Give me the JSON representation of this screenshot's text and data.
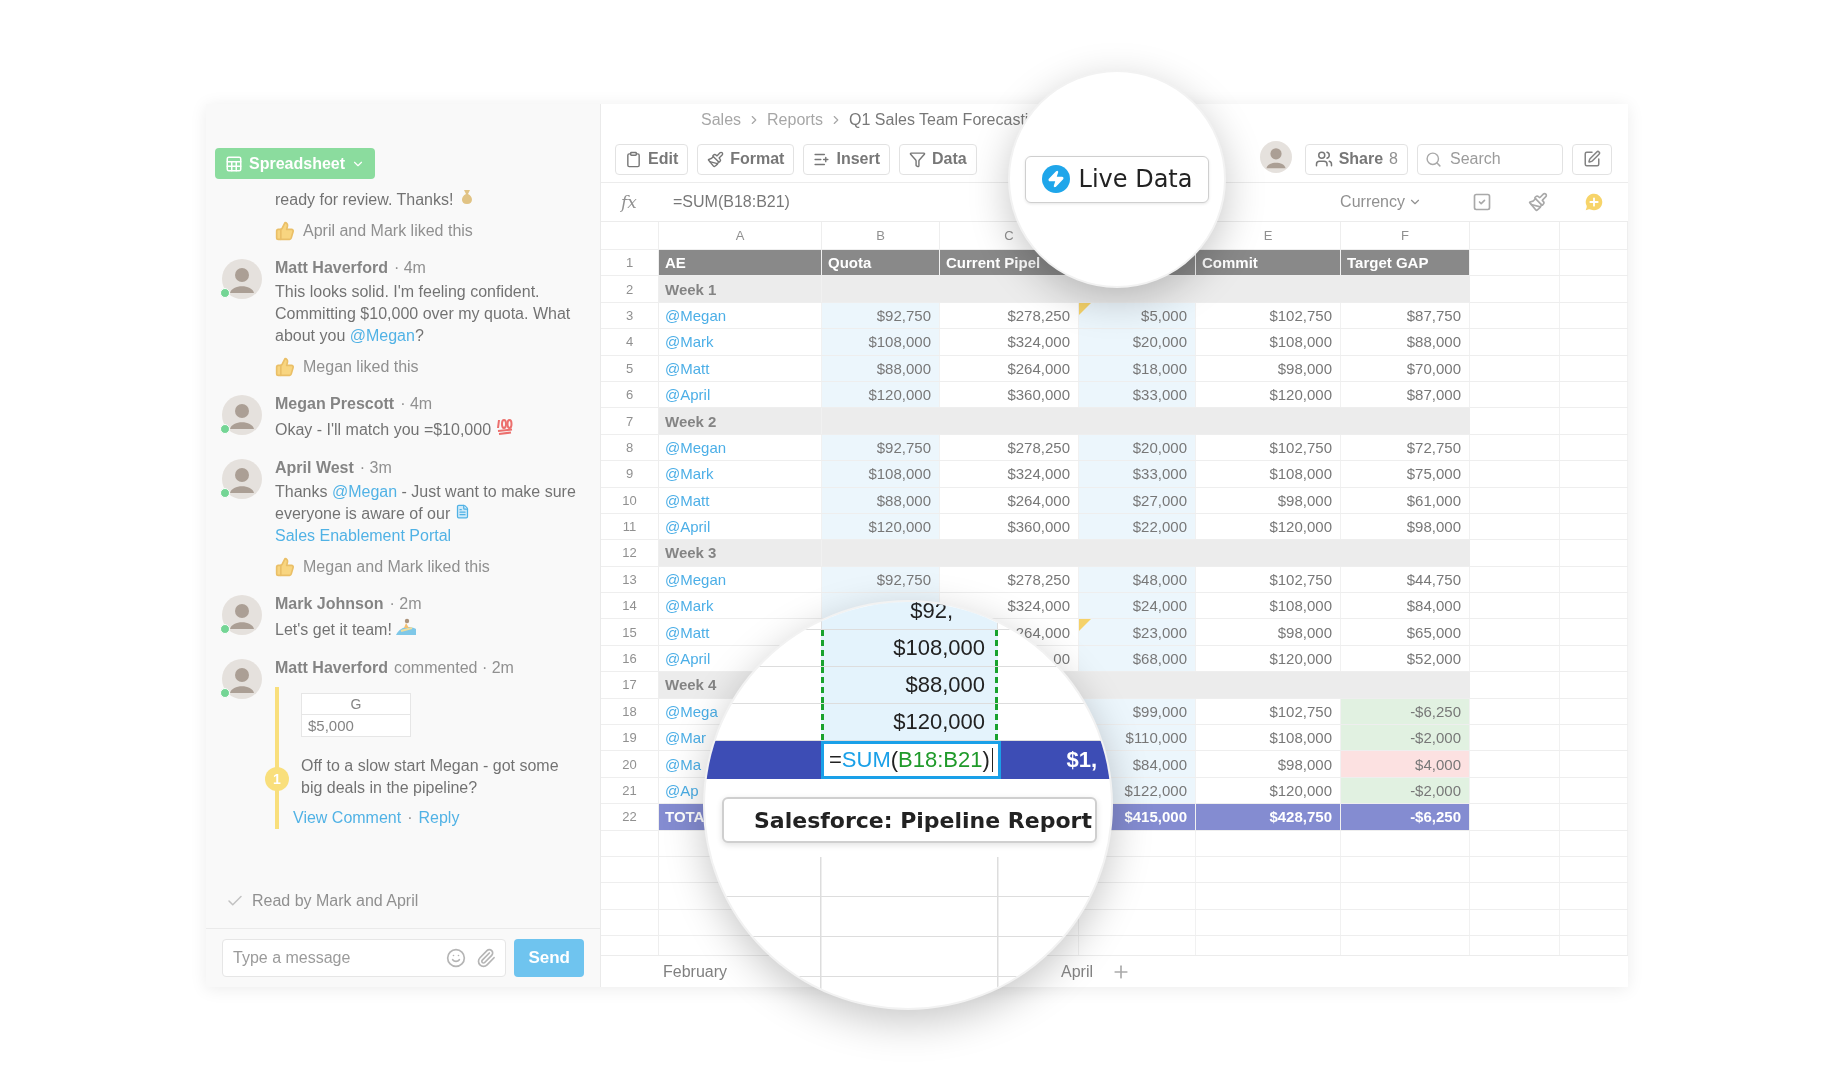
{
  "breadcrumb": [
    "Sales",
    "Reports",
    "Q1 Sales Team Forecasti"
  ],
  "view_button": {
    "label": "Spreadsheet"
  },
  "toolbar": {
    "buttons": [
      {
        "label": "Edit",
        "kind": "clipboard"
      },
      {
        "label": "Format",
        "kind": "paint"
      },
      {
        "label": "Insert",
        "kind": "insert"
      },
      {
        "label": "Data",
        "kind": "filter"
      }
    ],
    "share": {
      "label": "Share",
      "count": "8"
    },
    "search": {
      "placeholder": "Search"
    }
  },
  "formula_bar": {
    "fx": "fx",
    "formula": "=SUM(B18:B21)",
    "format": "Currency"
  },
  "columns": [
    "A",
    "B",
    "C",
    null,
    "E",
    "F"
  ],
  "rows": [
    {
      "n": "1",
      "kind": "header",
      "cells": [
        "AE",
        "Quota",
        "Current Pipel",
        null,
        "Commit",
        "Target GAP"
      ]
    },
    {
      "n": "2",
      "kind": "week",
      "cells": [
        "Week 1"
      ]
    },
    {
      "n": "3",
      "kind": "data",
      "cells": [
        "@Megan",
        "$92,750",
        "$278,250",
        "$5,000",
        "$102,750",
        "$87,750"
      ],
      "commented": true
    },
    {
      "n": "4",
      "kind": "data",
      "cells": [
        "@Mark",
        "$108,000",
        "$324,000",
        "$20,000",
        "$108,000",
        "$88,000"
      ],
      "commented": false
    },
    {
      "n": "5",
      "kind": "data",
      "cells": [
        "@Matt",
        "$88,000",
        "$264,000",
        "$18,000",
        "$98,000",
        "$70,000"
      ],
      "commented": false
    },
    {
      "n": "6",
      "kind": "data",
      "cells": [
        "@April",
        "$120,000",
        "$360,000",
        "$33,000",
        "$120,000",
        "$87,000"
      ],
      "commented": false
    },
    {
      "n": "7",
      "kind": "week",
      "cells": [
        "Week 2"
      ]
    },
    {
      "n": "8",
      "kind": "data",
      "cells": [
        "@Megan",
        "$92,750",
        "$278,250",
        "$20,000",
        "$102,750",
        "$72,750"
      ],
      "commented": false
    },
    {
      "n": "9",
      "kind": "data",
      "cells": [
        "@Mark",
        "$108,000",
        "$324,000",
        "$33,000",
        "$108,000",
        "$75,000"
      ],
      "commented": false
    },
    {
      "n": "10",
      "kind": "data",
      "cells": [
        "@Matt",
        "$88,000",
        "$264,000",
        "$27,000",
        "$98,000",
        "$61,000"
      ],
      "commented": false
    },
    {
      "n": "11",
      "kind": "data",
      "cells": [
        "@April",
        "$120,000",
        "$360,000",
        "$22,000",
        "$120,000",
        "$98,000"
      ],
      "commented": false
    },
    {
      "n": "12",
      "kind": "week",
      "cells": [
        "Week 3"
      ]
    },
    {
      "n": "13",
      "kind": "data",
      "cells": [
        "@Megan",
        "$92,750",
        "$278,250",
        "$48,000",
        "$102,750",
        "$44,750"
      ],
      "commented": false
    },
    {
      "n": "14",
      "kind": "data",
      "cells": [
        "@Mark",
        null,
        "$324,000",
        "$24,000",
        "$108,000",
        "$84,000"
      ],
      "commented": false
    },
    {
      "n": "15",
      "kind": "data",
      "cells": [
        "@Matt",
        null,
        "264,000",
        "$23,000",
        "$98,000",
        "$65,000"
      ],
      "commented": true
    },
    {
      "n": "16",
      "kind": "data",
      "cells": [
        "@April",
        null,
        "00",
        "$68,000",
        "$120,000",
        "$52,000"
      ],
      "commented": false
    },
    {
      "n": "17",
      "kind": "week",
      "cells": [
        "Week 4"
      ]
    },
    {
      "n": "18",
      "kind": "data",
      "cells": [
        "@Mega",
        null,
        null,
        "$99,000",
        "$102,750",
        "-$6,250"
      ],
      "missed": false
    },
    {
      "n": "19",
      "kind": "data",
      "cells": [
        "@Mar",
        null,
        null,
        "$110,000",
        "$108,000",
        "-$2,000"
      ],
      "missed": false
    },
    {
      "n": "20",
      "kind": "data",
      "cells": [
        "@Ma",
        null,
        null,
        "$84,000",
        "$98,000",
        "$4,000"
      ],
      "missed": true
    },
    {
      "n": "21",
      "kind": "data",
      "cells": [
        "@Ap",
        null,
        null,
        "$122,000",
        "$120,000",
        "-$2,000"
      ],
      "missed": false
    },
    {
      "n": "22",
      "kind": "total",
      "cells": [
        "TOTA",
        null,
        null,
        "$415,000",
        "$428,750",
        "-$6,250"
      ]
    }
  ],
  "sheet_tabs": [
    "February",
    "April"
  ],
  "messages": [
    {
      "kind": "fragment",
      "parts": [
        {
          "kind": "text",
          "text": "ready for review. Thanks! "
        },
        {
          "kind": "money-emoji"
        }
      ],
      "likes": "April and Mark liked this"
    },
    {
      "kind": "message",
      "author": "Matt Haverford",
      "meta": "· 4m",
      "online": true,
      "parts": [
        {
          "kind": "text",
          "text": "This looks solid. I'm feeling confident. Committing $10,000 over my quota. What about you "
        },
        {
          "kind": "mention",
          "text": "@Megan"
        },
        {
          "kind": "text",
          "text": "?"
        }
      ],
      "likes": "Megan liked this"
    },
    {
      "kind": "message",
      "author": "Megan Prescott",
      "meta": "· 4m",
      "online": true,
      "parts": [
        {
          "kind": "text",
          "text": "Okay - I'll match you =$10,000 "
        },
        {
          "kind": "hundred-emoji"
        }
      ]
    },
    {
      "kind": "message",
      "author": "April West",
      "meta": "· 3m",
      "online": true,
      "parts": [
        {
          "kind": "text",
          "text": "Thanks "
        },
        {
          "kind": "mention",
          "text": "@Megan"
        },
        {
          "kind": "text",
          "text": " - Just want to make sure everyone is aware of our "
        },
        {
          "kind": "doc-link",
          "text": "Sales Enablement Portal"
        }
      ],
      "likes": "Megan and Mark liked this"
    },
    {
      "kind": "message",
      "author": "Mark Johnson",
      "meta": "· 2m",
      "online": true,
      "parts": [
        {
          "kind": "text",
          "text": "Let's get it team! "
        },
        {
          "kind": "surf-emoji"
        }
      ]
    },
    {
      "kind": "comment",
      "author": "Matt Haverford",
      "meta": "commented · 2m",
      "online": true,
      "preview": {
        "column": "G",
        "value": "$5,000"
      },
      "badge": "1",
      "comment": "Off to a slow start Megan - got some big deals in the pipeline?",
      "actions": [
        "View Comment",
        "Reply"
      ],
      "separator": "·"
    }
  ],
  "read_receipt": "Read by Mark and April",
  "composer": {
    "placeholder": "Type a message",
    "send": "Send"
  },
  "live_data_lens": {
    "label": "Live Data"
  },
  "formula_lens": {
    "cells": [
      "$92,",
      "$108,000",
      "$88,000",
      "$120,000"
    ],
    "editor": [
      {
        "kind": "plain",
        "text": "="
      },
      {
        "kind": "function",
        "text": "SUM"
      },
      {
        "kind": "plain",
        "text": "("
      },
      {
        "kind": "range",
        "text": "B18:B21"
      },
      {
        "kind": "plain",
        "text": ")"
      }
    ],
    "next_value": "$1,",
    "source": "Salesforce: Pipeline Report"
  }
}
